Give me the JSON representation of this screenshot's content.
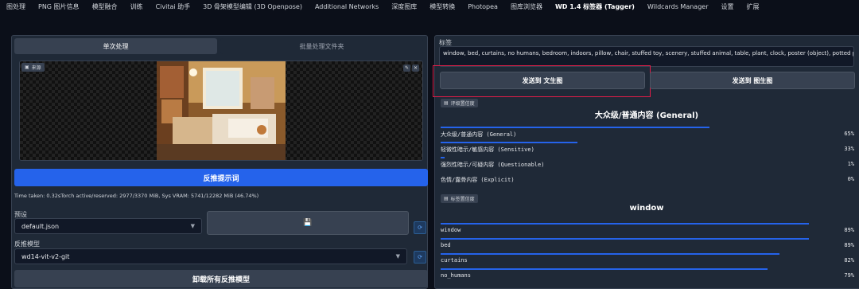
{
  "topbar": {
    "tabs": [
      {
        "label": "图处理",
        "active": false
      },
      {
        "label": "PNG 图片信息",
        "active": false
      },
      {
        "label": "模型融合",
        "active": false
      },
      {
        "label": "训练",
        "active": false
      },
      {
        "label": "Civitai 助手",
        "active": false
      },
      {
        "label": "3D 骨架模型编辑 (3D Openpose)",
        "active": false
      },
      {
        "label": "Additional Networks",
        "active": false
      },
      {
        "label": "深度图库",
        "active": false
      },
      {
        "label": "模型转换",
        "active": false
      },
      {
        "label": "Photopea",
        "active": false
      },
      {
        "label": "图库浏览器",
        "active": false
      },
      {
        "label": "WD 1.4 标签器 (Tagger)",
        "active": true
      },
      {
        "label": "Wildcards Manager",
        "active": false
      },
      {
        "label": "设置",
        "active": false
      },
      {
        "label": "扩展",
        "active": false
      }
    ]
  },
  "left": {
    "subtab_single": "单次处理",
    "subtab_batch": "批量处理文件夹",
    "source_label": "来源",
    "interrogate_label": "反推提示词",
    "time_text": "Time taken: 0.32sTorch active/reserved: 2977/3370 MiB, Sys VRAM: 5741/12282 MiB (46.74%)",
    "preset_label": "预设",
    "preset_value": "default.json",
    "model_label": "反推模型",
    "model_value": "wd14-vit-v2-git",
    "unload_label": "卸载所有反推模型"
  },
  "right": {
    "tags_label": "标签",
    "tags_text": "window, bed, curtains, no humans, bedroom, indoors, pillow, chair, stuffed toy, scenery, stuffed animal, table, plant, clock, poster (object), potted plant, teddy bear",
    "send_txt2img": "发送到 文生图",
    "send_img2img": "发送到 图生图",
    "rating": {
      "label": "评级置信度",
      "title": "大众级/普通内容 (General)",
      "rows": [
        {
          "name": "大众级/普通内容 (General)",
          "pct": "65%",
          "value": 0.65
        },
        {
          "name": "轻微性暗示/敏感内容 (Sensitive)",
          "pct": "33%",
          "value": 0.33
        },
        {
          "name": "强烈性暗示/可疑内容 (Questionable)",
          "pct": "1%",
          "value": 0.01
        },
        {
          "name": "色情/露骨内容 (Explicit)",
          "pct": "0%",
          "value": 0.0
        }
      ]
    },
    "tags_conf": {
      "label": "标签置信度",
      "title": "window",
      "rows": [
        {
          "name": "window",
          "pct": "89%",
          "value": 0.89
        },
        {
          "name": "bed",
          "pct": "89%",
          "value": 0.89
        },
        {
          "name": "curtains",
          "pct": "82%",
          "value": 0.82
        },
        {
          "name": "no_humans",
          "pct": "79%",
          "value": 0.79
        }
      ]
    }
  },
  "colors": {
    "accent": "#2563eb",
    "highlight": "#e11d48",
    "background": "#0b0f19"
  }
}
